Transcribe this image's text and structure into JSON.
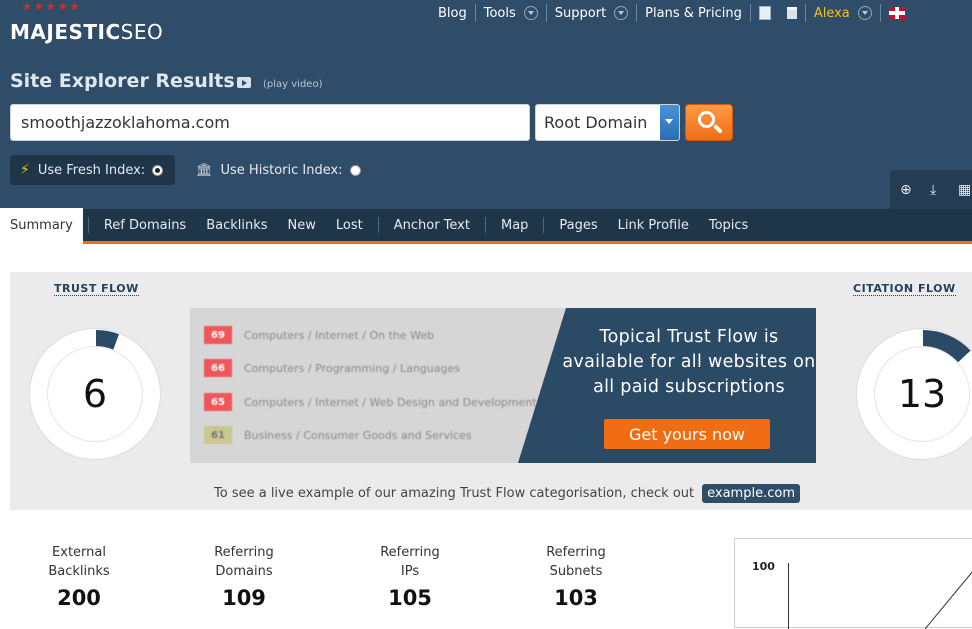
{
  "brand": {
    "name_bold": "MAJESTIC",
    "name_light": "SEO"
  },
  "topnav": {
    "blog": "Blog",
    "tools": "Tools",
    "support": "Support",
    "plans": "Plans & Pricing",
    "user": "Alexa"
  },
  "page": {
    "title": "Site Explorer Results",
    "play_video": "(play video)"
  },
  "search": {
    "value": "smoothjazzoklahoma.com",
    "scope": "Root Domain"
  },
  "index": {
    "fresh": "Use Fresh Index:",
    "historic": "Use Historic Index:",
    "selected": "fresh"
  },
  "tabs": [
    "Summary",
    "Ref Domains",
    "Backlinks",
    "New",
    "Lost",
    "Anchor Text",
    "Map",
    "Pages",
    "Link Profile",
    "Topics"
  ],
  "flows": {
    "trust_label": "TRUST FLOW",
    "trust_value": "6",
    "citation_label": "CITATION FLOW",
    "citation_value": "13"
  },
  "topical": {
    "rows": [
      {
        "score": "69",
        "topic": "Computers / Internet / On the Web",
        "color": "#f0575a"
      },
      {
        "score": "66",
        "topic": "Computers / Programming / Languages",
        "color": "#f0575a"
      },
      {
        "score": "65",
        "topic": "Computers / Internet / Web Design and Development",
        "color": "#f0575a"
      },
      {
        "score": "61",
        "topic": "Business / Consumer Goods and Services",
        "color": "#c9c98f"
      }
    ],
    "promo_text": "Topical Trust Flow is available for all websites on all paid subscriptions",
    "promo_button": "Get yours now",
    "example_text": "To see a live example of our amazing Trust Flow categorisation, check out",
    "example_link": "example.com"
  },
  "stats": [
    {
      "l1": "External",
      "l2": "Backlinks",
      "value": "200"
    },
    {
      "l1": "Referring",
      "l2": "Domains",
      "value": "109"
    },
    {
      "l1": "Referring",
      "l2": "IPs",
      "value": "105"
    },
    {
      "l1": "Referring",
      "l2": "Subnets",
      "value": "103"
    }
  ],
  "mini_chart": {
    "ymax": "100"
  },
  "colors": {
    "header": "#2f4d68",
    "accent": "#f06d14",
    "gauge": "#2a4a66"
  }
}
